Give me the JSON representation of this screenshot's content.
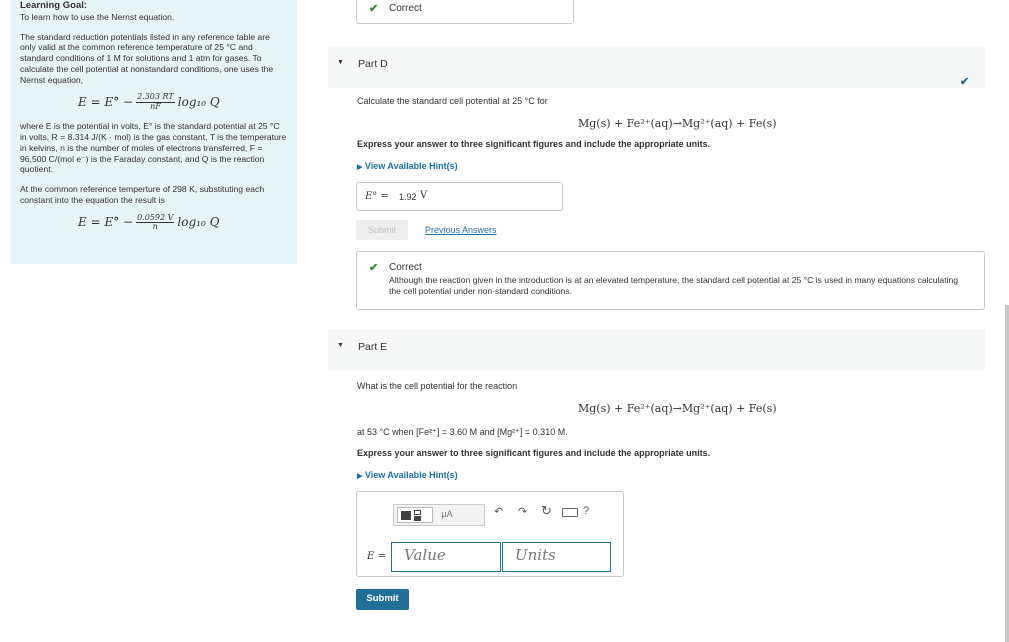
{
  "learning_goal": {
    "title": "Learning Goal:",
    "intro": "To learn how to use the Nernst equation.",
    "p1": "The standard reduction potentials listed in any reference table are only valid at the common reference temperature of 25 °C and standard conditions of 1 M for solutions and 1 atm for gases. To calculate the cell potential at nonstandard conditions, one uses the Nernst equation,",
    "eq1": {
      "lhs": "E = E° −",
      "num": "2.303 RT",
      "den": "nF",
      "log": "log₁₀ Q"
    },
    "p2": "where E is the potential in volts, E° is the standard potential at 25 °C in volts, R = 8.314 J/(K · mol) is the gas constant, T is the temperature in kelvins, n is the number of moles of electrons transferred, F = 96,500 C/(mol e⁻) is the Faraday constant, and Q is the reaction quotient.",
    "p3": "At the common reference temperture of 298 K, substituting each constant into the equation the result is",
    "eq2": {
      "lhs": "E = E° −",
      "num": "0.0592 V",
      "den": "n",
      "log": "log₁₀ Q"
    }
  },
  "top_feedback": {
    "label": "Correct"
  },
  "part_d": {
    "label": "Part D",
    "question": "Calculate the standard cell potential at 25 °C for",
    "reaction": "Mg(s) + Fe²⁺(aq)→Mg²⁺(aq) + Fe(s)",
    "instructions": "Express your answer to three significant figures and include the appropriate units.",
    "hint": "View Available Hint(s)",
    "answer_label": "E° =",
    "answer_value": "1.92",
    "answer_unit": "V",
    "submit_label": "Submit",
    "previous_answers": "Previous Answers",
    "feedback_title": "Correct",
    "feedback_text": "Although the reaction given in the introduction is at an elevated temperature, the standard cell potential at 25 °C is used in many equations calculating the cell potential under non-standard conditions."
  },
  "part_e": {
    "label": "Part E",
    "question": "What is the cell potential for the reaction",
    "reaction": "Mg(s) + Fe²⁺(aq)→Mg²⁺(aq) + Fe(s)",
    "conditions": "at 53 °C when [Fe²⁺] = 3.60 M and [Mg²⁺] = 0.310 M.",
    "instructions": "Express your answer to three significant figures and include the appropriate units.",
    "hint": "View Available Hint(s)",
    "toolbar": {
      "units_tool": "μA",
      "help": "?"
    },
    "answer_label": "E =",
    "value_placeholder": "Value",
    "units_placeholder": "Units",
    "submit_label": "Submit"
  },
  "colors": {
    "accent": "#1f6f96",
    "correct": "#2e8b3a",
    "panel": "#e5f4f5"
  }
}
